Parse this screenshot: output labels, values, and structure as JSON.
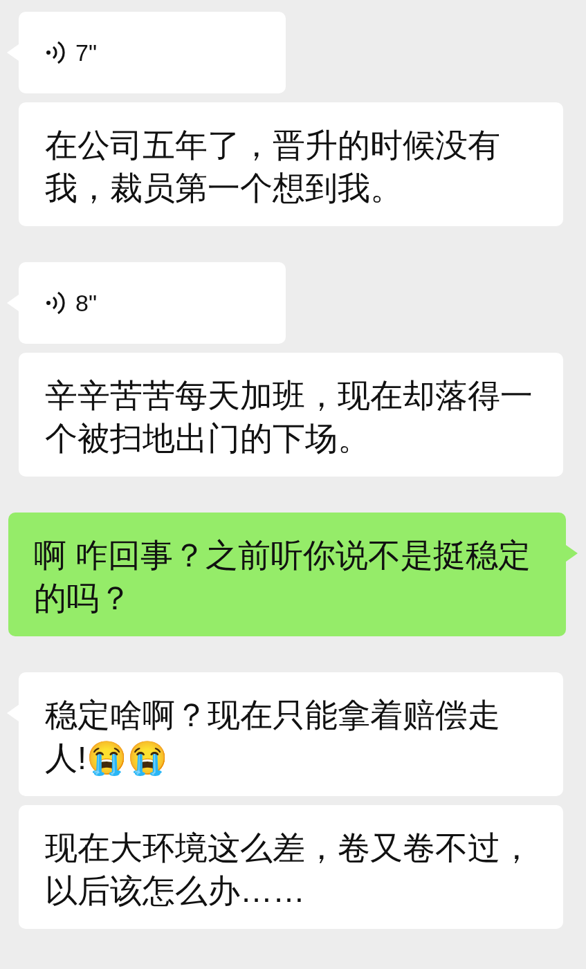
{
  "groups": [
    {
      "sent": false,
      "messages": [
        {
          "kind": "voice",
          "duration": "7\""
        },
        {
          "kind": "text",
          "text": "在公司五年了，晋升的时候没有我，裁员第一个想到我。"
        }
      ]
    },
    {
      "sent": false,
      "messages": [
        {
          "kind": "voice",
          "duration": "8\""
        },
        {
          "kind": "text",
          "text": "辛辛苦苦每天加班，现在却落得一个被扫地出门的下场。"
        }
      ]
    },
    {
      "sent": true,
      "messages": [
        {
          "kind": "text",
          "text": "啊 咋回事？之前听你说不是挺稳定的吗？"
        }
      ]
    },
    {
      "sent": false,
      "messages": [
        {
          "kind": "text",
          "text": "稳定啥啊？现在只能拿着赔偿走人!😭😭"
        },
        {
          "kind": "text",
          "text": "现在大环境这么差，卷又卷不过，以后该怎么办……"
        }
      ]
    }
  ]
}
